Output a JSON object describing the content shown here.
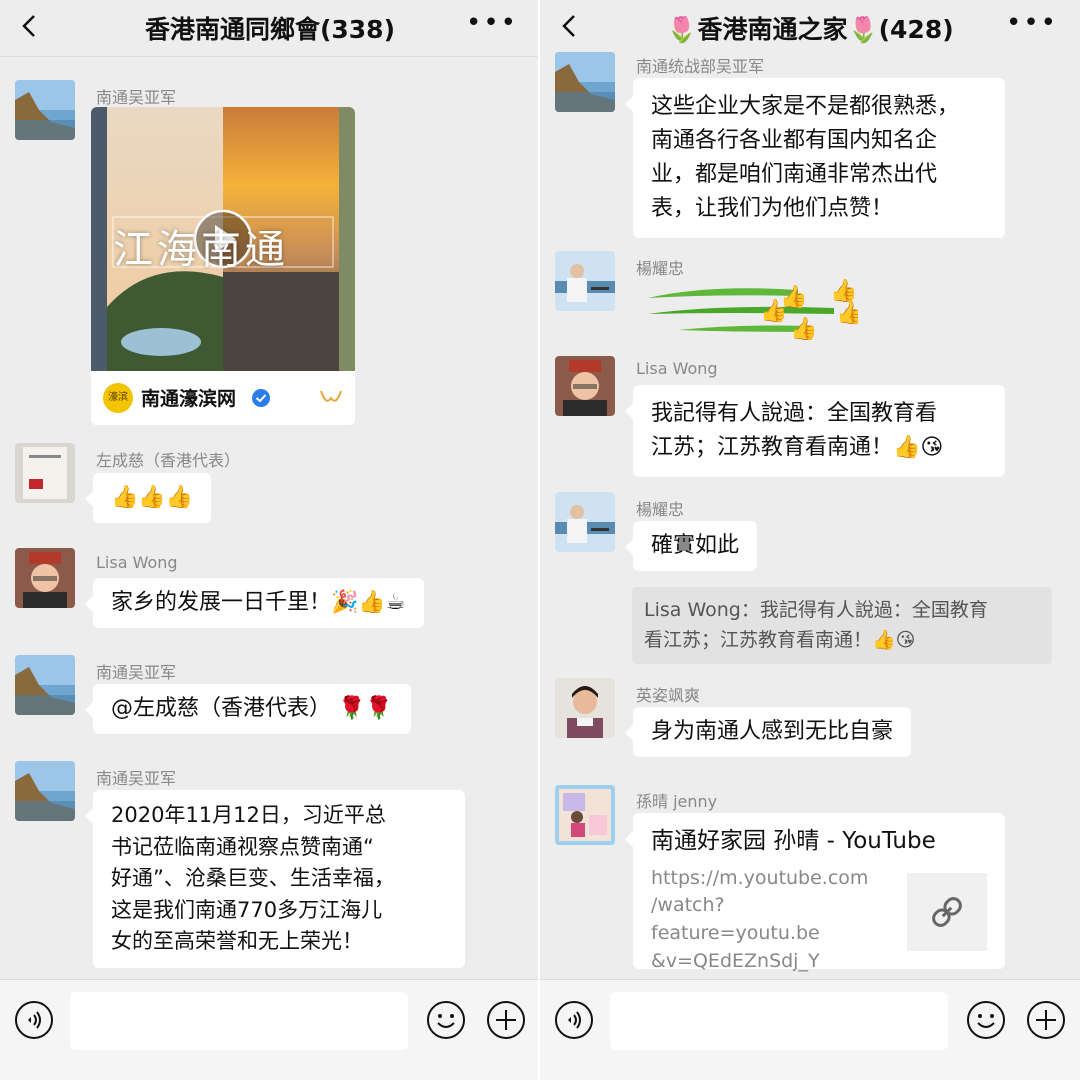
{
  "left": {
    "title": "香港南通同鄉會(338)",
    "messages": [
      {
        "sender": "南通吴亚军",
        "video": {
          "overlay": "江海南通",
          "source_logo": "濠滨",
          "source": "南通濠滨网"
        }
      },
      {
        "sender": "左成慈（香港代表）",
        "emoji": "👍👍👍"
      },
      {
        "sender": "Lisa   Wong",
        "text": "家乡的发展一日千里！",
        "emoji": "🎉👍☕"
      },
      {
        "sender": "南通吴亚军",
        "text": "@左成慈（香港代表）",
        "emoji": "🌹🌹"
      },
      {
        "sender": "南通吴亚军",
        "lines": [
          "2020年11月12日，习近平总",
          "书记莅临南通视察点赞南通“",
          "好通”、沧桑巨变、生活幸福，",
          "这是我们南通770多万江海儿",
          "女的至高荣誉和无上荣光！"
        ]
      }
    ]
  },
  "right": {
    "title": "🌷香港南通之家🌷(428)",
    "messages": [
      {
        "sender": "南通统战部吴亚军",
        "lines": [
          "这些企业大家是不是都很熟悉，",
          "南通各行各业都有国内知名企",
          "业，都是咱们南通非常杰出代",
          "表，让我们为他们点赞！"
        ]
      },
      {
        "sender": "楊耀忠",
        "emoji": "👍"
      },
      {
        "sender": "Lisa   Wong",
        "lines": [
          "我記得有人說過：全国教育看",
          "江苏；江苏教育看南通！"
        ],
        "emoji": "👍😘"
      },
      {
        "sender": "楊耀忠",
        "text": "確實如此"
      },
      {
        "quote": [
          "Lisa   Wong：我記得有人說過：全国教育",
          "看江苏；江苏教育看南通！"
        ],
        "emoji": "👍😘"
      },
      {
        "sender": "英姿飒爽",
        "text": "身为南通人感到无比自豪"
      },
      {
        "sender": "孫晴 jenny",
        "link": {
          "title": "南通好家园 孙晴 - YouTube",
          "url": [
            "https://m.youtube.com",
            "/watch?feature=youtu.be",
            "&v=QEdEZnSdj_Y"
          ]
        }
      }
    ]
  },
  "colors": {
    "accent_green": "#07c160",
    "bubble": "#ffffff",
    "bg": "#ededed",
    "link_icon_bg": "#f0f0f0"
  },
  "icons": [
    "back-arrow-icon",
    "more-icon",
    "voice-icon",
    "emoji-face-icon",
    "plus-icon",
    "play-icon",
    "verified-icon",
    "link-icon"
  ]
}
